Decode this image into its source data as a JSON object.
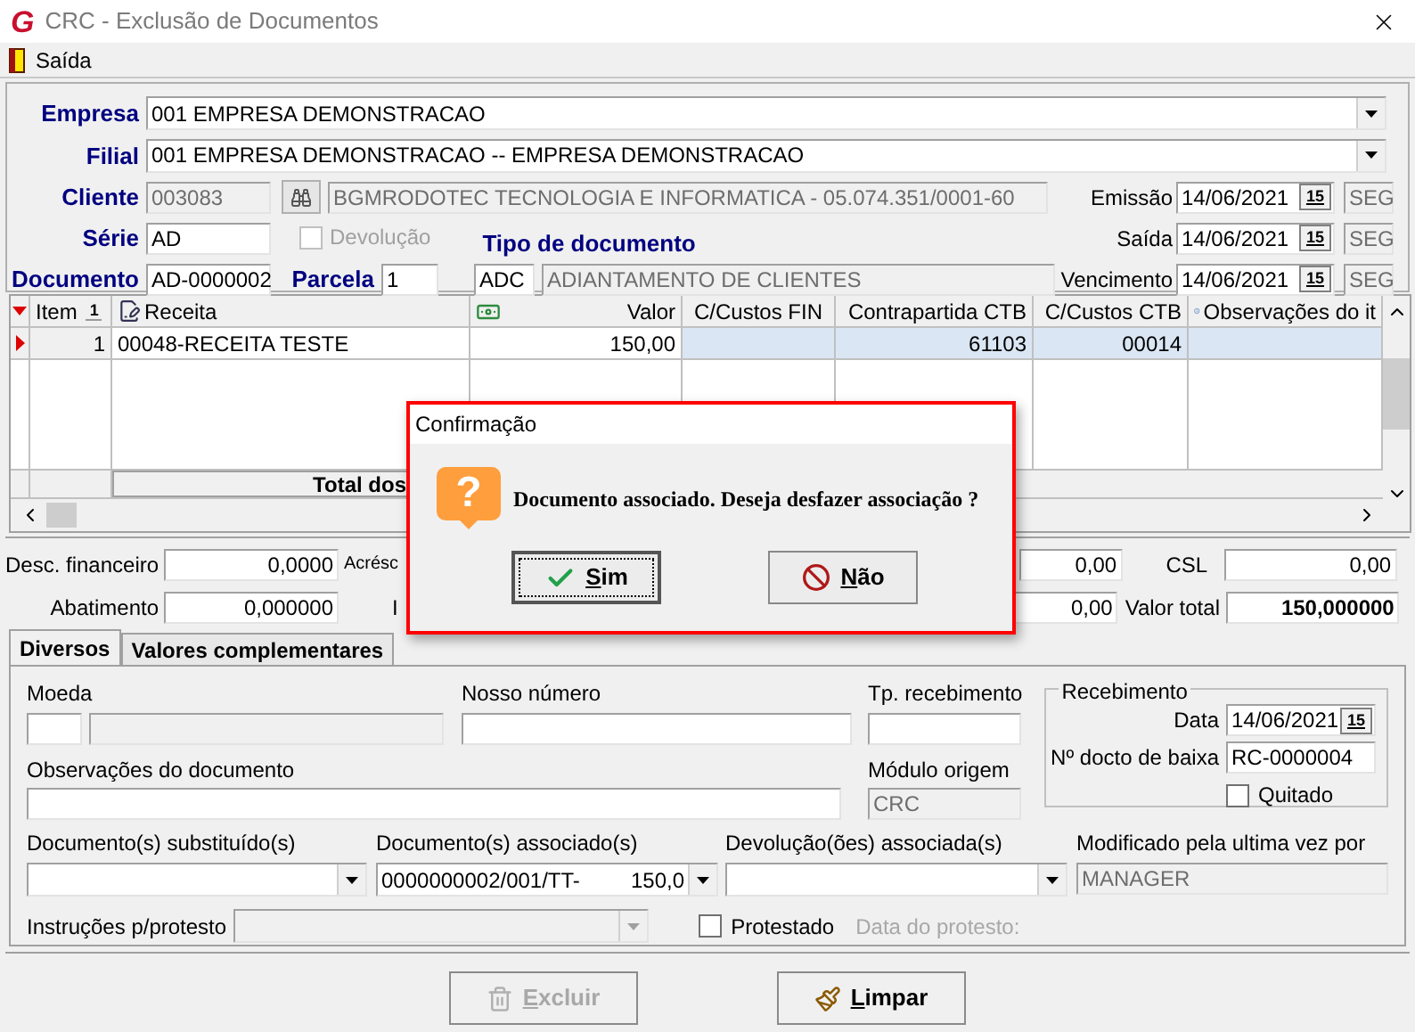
{
  "window": {
    "logo": "G",
    "title": "CRC - Exclusão de Documentos"
  },
  "menu": [
    {
      "label": "Saída"
    }
  ],
  "header": {
    "empresa": {
      "label": "Empresa",
      "value": "001 EMPRESA DEMONSTRACAO"
    },
    "filial": {
      "label": "Filial",
      "value": "001 EMPRESA DEMONSTRACAO -- EMPRESA DEMONSTRACAO"
    },
    "cliente": {
      "label": "Cliente",
      "code": "003083",
      "name": "BGMRODOTEC TECNOLOGIA  E INFORMATICA - 05.074.351/0001-60"
    },
    "serie": {
      "label": "Série",
      "value": "AD"
    },
    "devolucao": {
      "label": "Devolução",
      "checked": false,
      "disabled": true
    },
    "documento": {
      "label": "Documento",
      "value": "AD-0000002"
    },
    "parcela": {
      "label": "Parcela",
      "value": "1"
    },
    "tipo": {
      "label": "Tipo de documento",
      "code": "ADC",
      "name": "ADIANTAMENTO DE CLIENTES"
    },
    "dates": [
      {
        "label": "Emissão",
        "value": "14/06/2021",
        "calendar": "15",
        "weekday": "SEG"
      },
      {
        "label": "Saída",
        "value": "14/06/2021",
        "calendar": "15",
        "weekday": "SEG"
      },
      {
        "label": "Vencimento",
        "value": "14/06/2021",
        "calendar": "15",
        "weekday": "SEG"
      }
    ]
  },
  "grid": {
    "columns": [
      {
        "label": "Item",
        "sort": "1"
      },
      {
        "label": "Receita"
      },
      {
        "label": "Valor"
      },
      {
        "label": "C/Custos FIN"
      },
      {
        "label": "Contrapartida CTB"
      },
      {
        "label": "C/Custos CTB"
      },
      {
        "label": "Observações do it"
      }
    ],
    "rows": [
      {
        "selected": true,
        "item": "1",
        "receita": "00048-RECEITA TESTE",
        "valor": "150,00",
        "contrapartida": "61103",
        "custos_ctb": "00014"
      }
    ],
    "footer": "Total dos"
  },
  "totals": {
    "desc_financeiro": {
      "label": "Desc. financeiro",
      "value": "0,0000"
    },
    "acrescimo": {
      "label": "Acrésc"
    },
    "abatimento": {
      "label": "Abatimento",
      "value": "0,000000"
    },
    "ir": {
      "label": "I"
    },
    "hidden_fields": [
      "0,00",
      "0,00"
    ],
    "csl": {
      "label": "CSL",
      "value": "0,00"
    },
    "valor_total": {
      "label": "Valor total",
      "value": "150,000000"
    }
  },
  "tabs": [
    {
      "label": "Diversos",
      "selected": true
    },
    {
      "label": "Valores complementares",
      "selected": false
    }
  ],
  "diversos": {
    "moeda": {
      "label": "Moeda"
    },
    "nosso_numero": {
      "label": "Nosso número"
    },
    "tp_recebimento": {
      "label": "Tp. recebimento"
    },
    "observacoes": {
      "label": "Observações do documento"
    },
    "modulo_origem": {
      "label": "Módulo origem",
      "value": "CRC"
    },
    "recebimento": {
      "title": "Recebimento",
      "data": {
        "label": "Data",
        "value": "14/06/2021",
        "calendar": "15"
      },
      "baixa": {
        "label": "Nº docto de baixa",
        "value": "RC-0000004"
      },
      "quitado": {
        "label": "Quitado",
        "checked": false
      }
    },
    "substituidos": {
      "label": "Documento(s) substituído(s)"
    },
    "associados": {
      "label": "Documento(s) associado(s)",
      "value": "0000000002/001/TT-",
      "amount": "150,0"
    },
    "devolucoes": {
      "label": "Devolução(ões) associada(s)"
    },
    "modificado": {
      "label": "Modificado pela ultima vez por",
      "value": "MANAGER"
    },
    "instrucoes": {
      "label": "Instruções p/protesto"
    },
    "protestado": {
      "label": "Protestado",
      "checked": false
    },
    "data_protesto": {
      "label": "Data do protesto:",
      "disabled": true
    }
  },
  "buttons": [
    {
      "label": "Excluir",
      "kind": "delete",
      "disabled": true
    },
    {
      "label": "Limpar",
      "kind": "clear",
      "disabled": false
    }
  ],
  "dialog": {
    "title": "Confirmação",
    "icon": "?",
    "message": "Documento associado. Deseja desfazer associação ?",
    "buttons": [
      {
        "label": "Sim",
        "kind": "yes",
        "focused": true
      },
      {
        "label": "Não",
        "kind": "no",
        "focused": false
      }
    ]
  }
}
